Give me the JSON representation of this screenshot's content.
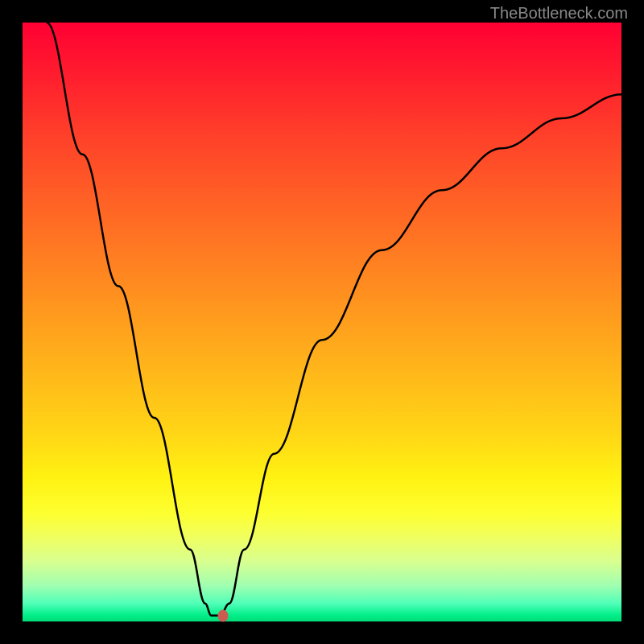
{
  "watermark": "TheBottleneck.com",
  "chart_data": {
    "type": "line",
    "title": "",
    "xlabel": "",
    "ylabel": "",
    "xlim": [
      0,
      100
    ],
    "ylim": [
      0,
      100
    ],
    "series": [
      {
        "name": "bottleneck-curve",
        "points": [
          {
            "x": 4,
            "y": 100
          },
          {
            "x": 10,
            "y": 78
          },
          {
            "x": 16,
            "y": 56
          },
          {
            "x": 22,
            "y": 34
          },
          {
            "x": 28,
            "y": 12
          },
          {
            "x": 30.5,
            "y": 3
          },
          {
            "x": 31.5,
            "y": 1
          },
          {
            "x": 33,
            "y": 1
          },
          {
            "x": 34.5,
            "y": 3
          },
          {
            "x": 37,
            "y": 12
          },
          {
            "x": 42,
            "y": 28
          },
          {
            "x": 50,
            "y": 47
          },
          {
            "x": 60,
            "y": 62
          },
          {
            "x": 70,
            "y": 72
          },
          {
            "x": 80,
            "y": 79
          },
          {
            "x": 90,
            "y": 84
          },
          {
            "x": 100,
            "y": 88
          }
        ]
      }
    ],
    "marker": {
      "x": 33.5,
      "y": 1
    },
    "gradient_stops": [
      {
        "pos": 0,
        "color": "#ff0033"
      },
      {
        "pos": 50,
        "color": "#ffb000"
      },
      {
        "pos": 80,
        "color": "#ffff20"
      },
      {
        "pos": 100,
        "color": "#00dd77"
      }
    ]
  }
}
